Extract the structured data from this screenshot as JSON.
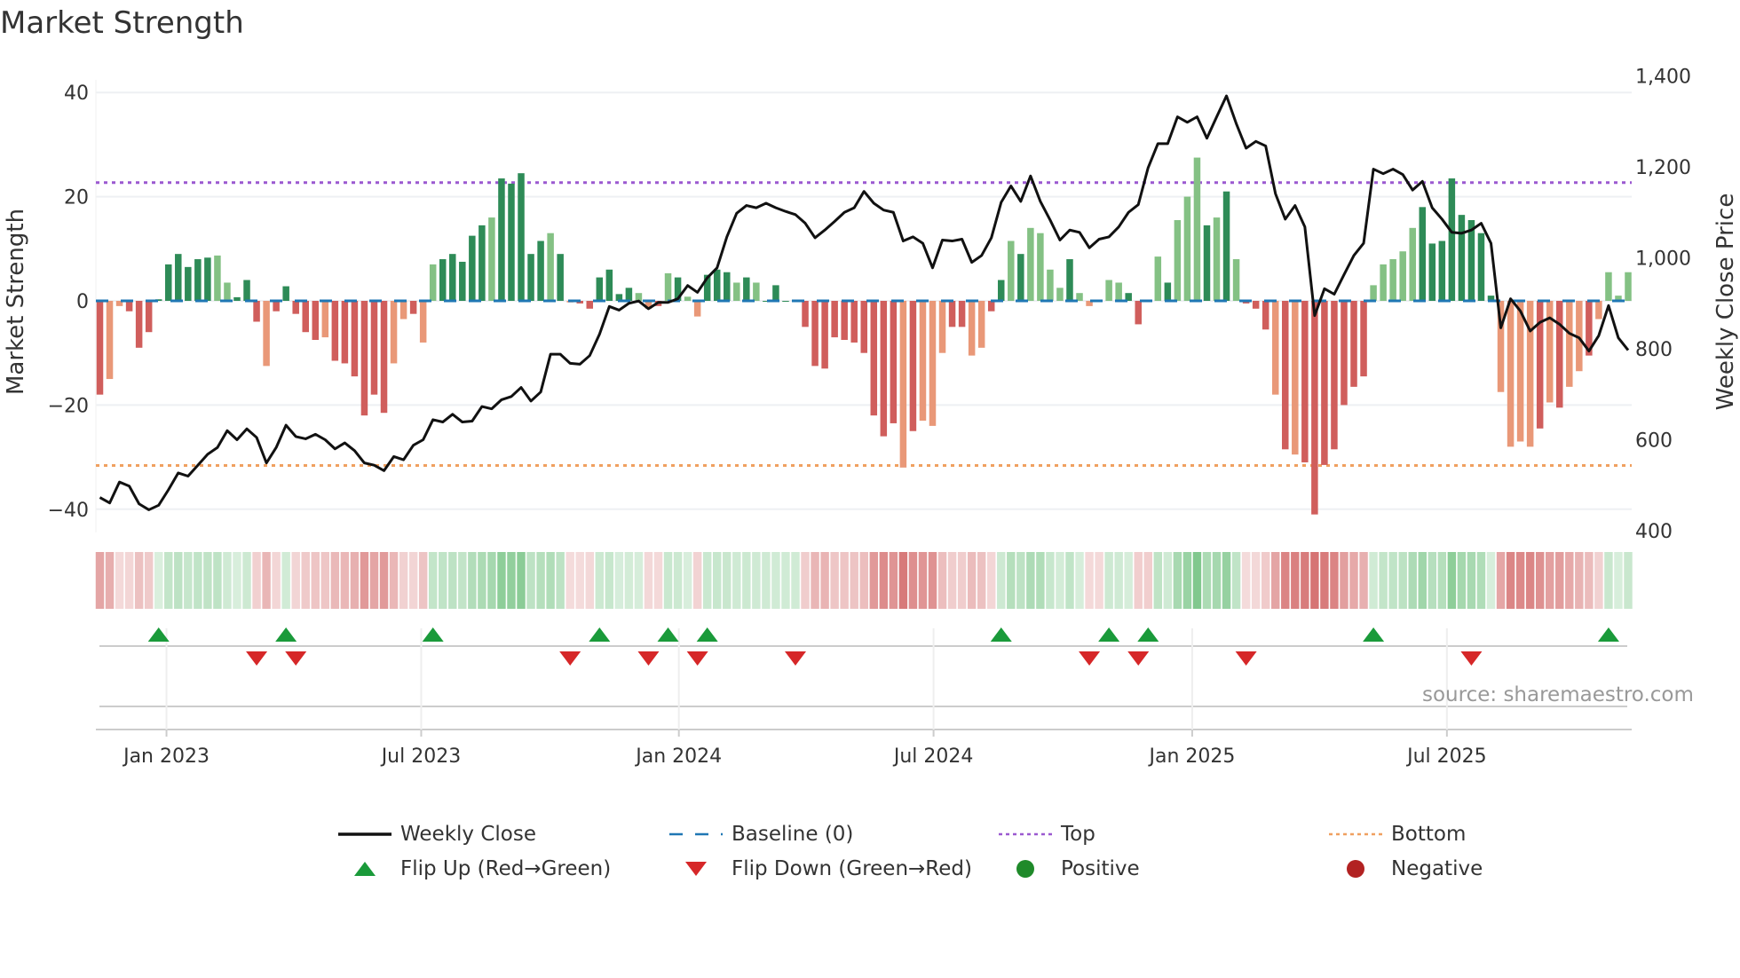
{
  "title": "Market Strength",
  "source": "source: sharemaestro.com",
  "chart_data": {
    "type": "bar+line",
    "title": "Market Strength",
    "ylabel": "Market Strength",
    "y2label": "Weekly Close Price",
    "ylim": [
      -45,
      44
    ],
    "y2lim": [
      400,
      1400
    ],
    "yticks": [
      "40",
      "20",
      "0",
      "−20",
      "−40"
    ],
    "yticks_values": [
      40,
      20,
      0,
      -20,
      -40
    ],
    "y2ticks": [
      "1,400",
      "1,200",
      "1,000",
      "800",
      "600",
      "400"
    ],
    "y2ticks_values": [
      1400,
      1200,
      1000,
      800,
      600,
      400
    ],
    "xticks": [
      "Jan 2023",
      "Jul 2023",
      "Jan 2024",
      "Jul 2024",
      "Jan 2025",
      "Jul 2025"
    ],
    "xticks_week_index": [
      6.8,
      32.8,
      59.1,
      85.1,
      111.5,
      137.5
    ],
    "top_level": 22.7,
    "bottom_level": -31.6,
    "strength": [
      -18,
      -15,
      -1,
      -2,
      -9,
      -6,
      0.3,
      7,
      9,
      6.5,
      8,
      8.3,
      8.7,
      3.5,
      0.7,
      4,
      -4,
      -12.5,
      -2,
      2.8,
      -2.5,
      -6,
      -7.5,
      -7,
      -11.5,
      -12,
      -14.5,
      -22,
      -18,
      -21.5,
      -12,
      -3.5,
      -2.5,
      -8,
      7,
      8,
      9,
      7.5,
      12.5,
      14.5,
      16,
      23.5,
      22.5,
      24.5,
      9,
      11.5,
      13,
      9,
      -0.3,
      -0.5,
      -1.5,
      4.5,
      6,
      1.3,
      2.5,
      1.5,
      -1.5,
      -1,
      5.3,
      4.5,
      0.8,
      -3,
      5,
      6,
      5.5,
      3.5,
      4.5,
      3.5,
      0,
      3,
      0,
      0,
      -5,
      -12.5,
      -13,
      -7,
      -7.5,
      -8,
      -10,
      -22,
      -26,
      -23.5,
      -32,
      -25,
      -23,
      -24,
      -10,
      -5,
      -5,
      -10.5,
      -9,
      -2,
      4,
      11.5,
      9,
      14,
      13,
      6,
      2.5,
      8,
      1.5,
      -1,
      0,
      4,
      3.5,
      1.5,
      -4.5,
      0,
      8.5,
      3.5,
      15.5,
      20,
      27.5,
      14.5,
      16,
      21,
      8,
      -0.5,
      -1.5,
      -5.5,
      -18,
      -28.5,
      -29.5,
      -31,
      -41,
      -31.5,
      -28.5,
      -20,
      -16.5,
      -14.5,
      3,
      7,
      8,
      9.5,
      14,
      18,
      11,
      11.5,
      23.5,
      16.5,
      15.5,
      13,
      1,
      -17.5,
      -28,
      -27,
      -28,
      -24.5,
      -19.5,
      -20.5,
      -16.5,
      -13.5,
      -10.5,
      -3.5,
      5.5,
      1,
      5.5
    ],
    "strength_shade": "dlldddddddddlldddldddddlddddddlldlldddddldddddldlddddddlldldlldddldlddddddddddddddldlllddllddldlllldllllldddldllldldldddldldddddddlllllddddddddlllldldlldlllllldld",
    "weekly_close": [
      473,
      461,
      507,
      498,
      459,
      446,
      456,
      490,
      527,
      520,
      544,
      568,
      583,
      620,
      600,
      624,
      605,
      549,
      583,
      632,
      607,
      602,
      612,
      600,
      580,
      593,
      576,
      549,
      544,
      532,
      563,
      556,
      588,
      600,
      644,
      639,
      656,
      639,
      641,
      673,
      668,
      688,
      695,
      715,
      685,
      705,
      788,
      788,
      768,
      766,
      785,
      832,
      893,
      885,
      900,
      905,
      888,
      902,
      902,
      910,
      939,
      924,
      956,
      978,
      1046,
      1098,
      1115,
      1110,
      1120,
      1110,
      1102,
      1095,
      1076,
      1044,
      1061,
      1080,
      1100,
      1110,
      1146,
      1120,
      1105,
      1100,
      1037,
      1046,
      1032,
      978,
      1039,
      1037,
      1041,
      990,
      1005,
      1044,
      1122,
      1158,
      1124,
      1180,
      1124,
      1083,
      1039,
      1061,
      1056,
      1022,
      1041,
      1046,
      1068,
      1100,
      1117,
      1198,
      1251,
      1251,
      1310,
      1298,
      1310,
      1263,
      1310,
      1356,
      1295,
      1241,
      1256,
      1246,
      1141,
      1085,
      1115,
      1068,
      873,
      932,
      920,
      963,
      1005,
      1032,
      1195,
      1185,
      1195,
      1183,
      1149,
      1168,
      1110,
      1085,
      1056,
      1054,
      1061,
      1076,
      1032,
      846,
      910,
      883,
      839,
      858,
      868,
      854,
      834,
      824,
      795,
      829,
      895,
      824,
      797
    ],
    "flip_up_week_index": [
      6,
      19,
      34,
      51,
      58,
      62,
      92,
      103,
      107,
      130,
      154
    ],
    "flip_down_week_index": [
      16,
      20,
      48,
      56,
      61,
      71,
      101,
      106,
      117,
      140
    ],
    "legend": [
      {
        "label": "Weekly Close",
        "symbol": "line"
      },
      {
        "label": "Baseline (0)",
        "symbol": "dash"
      },
      {
        "label": "Top",
        "symbol": "dot-top"
      },
      {
        "label": "Bottom",
        "symbol": "dot-bottom"
      },
      {
        "label": "Flip Up (Red→Green)",
        "symbol": "tri-up"
      },
      {
        "label": "Flip Down (Green→Red)",
        "symbol": "tri-down"
      },
      {
        "label": "Positive",
        "symbol": "circle-pos"
      },
      {
        "label": "Negative",
        "symbol": "circle-neg"
      }
    ],
    "legend_placement": "bottom",
    "colors": {
      "pos_dark": "#2e8b57",
      "pos_light": "#84c184",
      "neg_dark": "#d05e5c",
      "neg_light": "#e99878",
      "line": "#111111",
      "baseline": "#1f77b4",
      "top": "#9b59d0",
      "bottom": "#f0a060",
      "flip_up": "#1a9a3a",
      "flip_down": "#d62728",
      "positive": "#1f8a2a",
      "negative": "#b22222"
    }
  }
}
